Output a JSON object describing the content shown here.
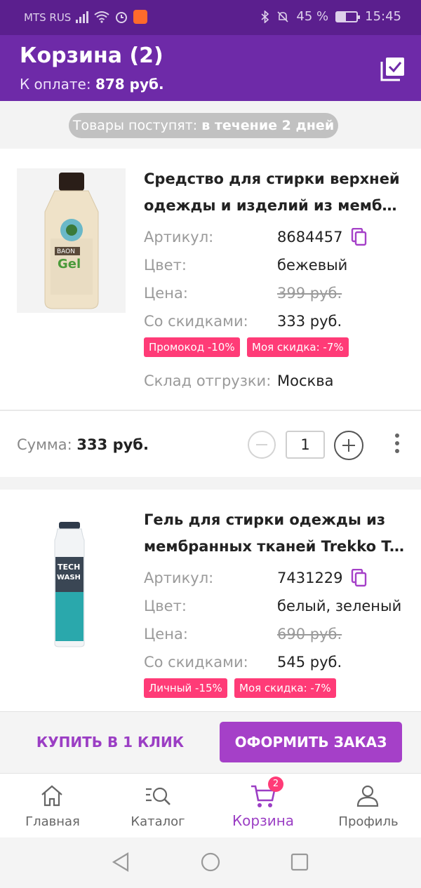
{
  "status_bar": {
    "carrier": "MTS RUS",
    "battery": "45 %",
    "time": "15:45"
  },
  "header": {
    "title": "Корзина (2)",
    "to_pay_label": "К оплате:",
    "to_pay_value": "878 руб."
  },
  "delivery": {
    "label": "Товары поступят:",
    "value": "в течение 2 дней"
  },
  "labels": {
    "article": "Артикул:",
    "color": "Цвет:",
    "price": "Цена:",
    "discounted": "Со скидками:",
    "warehouse": "Склад отгрузки:",
    "sum": "Сумма:"
  },
  "items": [
    {
      "title_line1": "Средство для стирки верхней",
      "title_line2": "одежды и изделий из мембра...",
      "article": "8684457",
      "color": "бежевый",
      "price": "399 руб.",
      "discounted_price": "333 руб.",
      "tags": [
        "Промокод -10%",
        "Моя скидка: -7%"
      ],
      "warehouse": "Москва",
      "sum": "333 руб.",
      "quantity": "1",
      "image_brand": "BAON",
      "image_text": "Gel"
    },
    {
      "title_line1": "Гель для стирки одежды из",
      "title_line2": "мембранных тканей Trekko Te...",
      "article": "7431229",
      "color": "белый, зеленый",
      "price": "690 руб.",
      "discounted_price": "545 руб.",
      "tags": [
        "Личный -15%",
        "Моя скидка: -7%"
      ],
      "image_brand": "TECH",
      "image_text": "WASH"
    }
  ],
  "actions": {
    "buy_one_click": "КУПИТЬ В 1 КЛИК",
    "checkout": "ОФОРМИТЬ ЗАКАЗ"
  },
  "bottom_nav": [
    {
      "label": "Главная",
      "icon": "home-icon"
    },
    {
      "label": "Каталог",
      "icon": "catalog-search-icon"
    },
    {
      "label": "Корзина",
      "icon": "cart-icon",
      "badge": "2",
      "active": true
    },
    {
      "label": "Профиль",
      "icon": "profile-icon"
    }
  ],
  "colors": {
    "header": "#6e2aa8",
    "status_bar": "#5b1f8e",
    "accent": "#a540c8",
    "tag": "#ff3b77"
  }
}
